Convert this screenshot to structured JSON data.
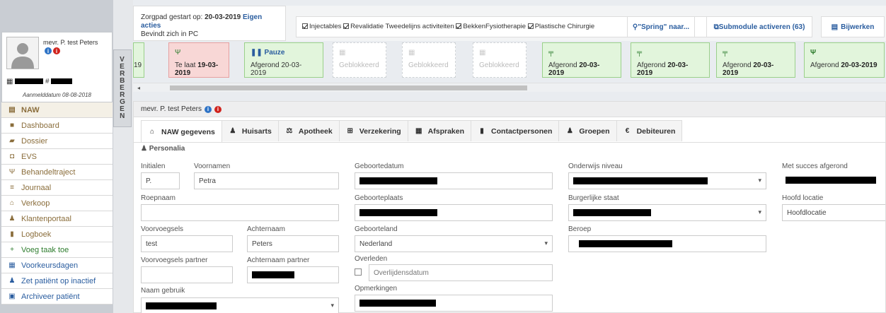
{
  "sidebar": {
    "toggle_label": "VERBERGEN",
    "patient": {
      "name": "mevr. P. test Peters",
      "id_line": "# ",
      "aanmelddatum": "Aanmelddatum 08-08-2018"
    },
    "menu": [
      {
        "label": "NAW",
        "icon": "id-card-icon"
      },
      {
        "label": "Dashboard",
        "icon": "bookmark-icon"
      },
      {
        "label": "Dossier",
        "icon": "folder-icon"
      },
      {
        "label": "EVS",
        "icon": "briefcase-icon"
      },
      {
        "label": "Behandeltraject",
        "icon": "stethoscope-icon"
      },
      {
        "label": "Journaal",
        "icon": "list-icon"
      },
      {
        "label": "Verkoop",
        "icon": "basket-icon"
      },
      {
        "label": "Klantenportaal",
        "icon": "user-icon"
      },
      {
        "label": "Logboek",
        "icon": "book-icon"
      },
      {
        "label": "Voeg taak toe",
        "icon": "plus-icon"
      },
      {
        "label": "Voorkeursdagen",
        "icon": "calendar-icon"
      },
      {
        "label": "Zet patiënt op inactief",
        "icon": "user-times-icon"
      },
      {
        "label": "Archiveer patiënt",
        "icon": "archive-icon"
      }
    ]
  },
  "status": {
    "zorgpad_prefix": "Zorgpad gestart op:",
    "zorgpad_date": "20-03-2019",
    "eigen_acties": "Eigen acties",
    "bevindt": "Bevindt zich in PC",
    "checks": [
      "Injectables",
      "Revalidatie Tweedelijns activiteiten",
      "BekkenFysiotherapie",
      "Plastische Chirurgie"
    ],
    "btn_spring": "\"Spring\" naar...",
    "btn_submodule": "Submodule activeren (63)",
    "btn_bijwerken": "Bijwerken"
  },
  "timeline": [
    {
      "text": "19",
      "date": "",
      "icon": ""
    },
    {
      "text": "Te laat",
      "date": "19-03-2019",
      "icon": "stethoscope-icon"
    },
    {
      "text": "Pauze",
      "date": "Afgerond 20-03-2019",
      "icon": "pause-icon"
    },
    {
      "text": "Geblokkeerd",
      "date": "",
      "icon": "calendar-icon"
    },
    {
      "text": "Geblokkeerd",
      "date": "",
      "icon": "calendar-icon"
    },
    {
      "text": "Geblokkeerd",
      "date": "",
      "icon": "calendar-icon"
    },
    {
      "text": "Afgerond",
      "date": "20-03-2019",
      "icon": "signpost-icon"
    },
    {
      "text": "Afgerond",
      "date": "20-03-2019",
      "icon": "signpost-icon"
    },
    {
      "text": "Afgerond",
      "date": "20-03-2019",
      "icon": "signpost-icon"
    },
    {
      "text": "Afgerond",
      "date": "20-03-2019",
      "icon": "stethoscope-icon"
    }
  ],
  "panel": {
    "title": "mevr. P. test Peters",
    "tabs": [
      {
        "label": "NAW gegevens",
        "icon": "home-icon"
      },
      {
        "label": "Huisarts",
        "icon": "user-md-icon"
      },
      {
        "label": "Apotheek",
        "icon": "balance-icon"
      },
      {
        "label": "Verzekering",
        "icon": "plus-square-icon"
      },
      {
        "label": "Afspraken",
        "icon": "calendar-icon"
      },
      {
        "label": "Contactpersonen",
        "icon": "address-book-icon"
      },
      {
        "label": "Groepen",
        "icon": "users-icon"
      },
      {
        "label": "Debiteuren",
        "icon": "euro-icon"
      }
    ],
    "section": "Personalia",
    "fields": {
      "initialen_label": "Initialen",
      "initialen_value": "P.",
      "voornamen_label": "Voornamen",
      "voornamen_value": "Petra",
      "roepnaam_label": "Roepnaam",
      "voorvoegsels_label": "Voorvoegsels",
      "voorvoegsels_value": "test",
      "achternaam_label": "Achternaam",
      "achternaam_value": "Peters",
      "vv_partner_label": "Voorvoegsels partner",
      "an_partner_label": "Achternaam partner",
      "naam_gebruik_label": "Naam gebruik",
      "geboortedatum_label": "Geboortedatum",
      "geboorteplaats_label": "Geboorteplaats",
      "geboorteland_label": "Geboorteland",
      "geboorteland_value": "Nederland",
      "overleden_label": "Overleden",
      "overlijdensdatum_placeholder": "Overlijdensdatum",
      "opmerkingen_label": "Opmerkingen",
      "onderwijs_label": "Onderwijs niveau",
      "burgerlijke_label": "Burgerlijke staat",
      "beroep_label": "Beroep",
      "met_succes_label": "Met succes afgerond",
      "hoofd_locatie_label": "Hoofd locatie",
      "hoofd_locatie_value": "Hoofdlocatie"
    }
  }
}
